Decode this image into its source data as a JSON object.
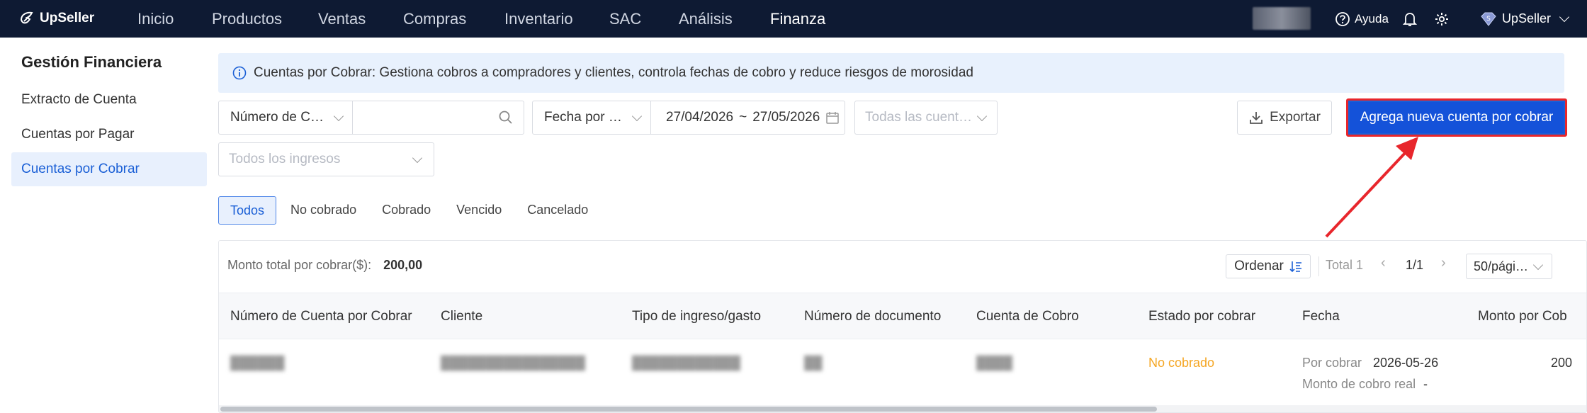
{
  "topnav": {
    "brand": "UpSeller",
    "items": [
      "Inicio",
      "Productos",
      "Ventas",
      "Compras",
      "Inventario",
      "SAC",
      "Análisis",
      "Finanza"
    ],
    "help": "Ayuda",
    "account": "UpSeller"
  },
  "sidebar": {
    "title": "Gestión Financiera",
    "items": [
      "Extracto de Cuenta",
      "Cuentas por Pagar",
      "Cuentas por Cobrar"
    ]
  },
  "info": {
    "text": "Cuentas por Cobrar: Gestiona cobros a compradores y clientes, controla fechas de cobro y reduce riesgos de morosidad"
  },
  "filters": {
    "search_field": "Número de C…",
    "search_value": "",
    "date_type": "Fecha por …",
    "date_from": "27/04/2026",
    "date_sep": "~",
    "date_to": "27/05/2026",
    "accounts_placeholder": "Todas las cuent…",
    "income_placeholder": "Todos los ingresos"
  },
  "actions": {
    "export": "Exportar",
    "add": "Agrega nueva cuenta por cobrar"
  },
  "tabs": [
    "Todos",
    "No cobrado",
    "Cobrado",
    "Vencido",
    "Cancelado"
  ],
  "summary": {
    "label": "Monto total por cobrar($):",
    "value": "200,00"
  },
  "toolbar": {
    "sort": "Ordenar",
    "total": "Total 1",
    "page": "1/1",
    "page_size": "50/pági…"
  },
  "table": {
    "columns": [
      "Número de Cuenta por Cobrar",
      "Cliente",
      "Tipo de ingreso/gasto",
      "Número de documento",
      "Cuenta de Cobro",
      "Estado por cobrar",
      "Fecha",
      "Monto por Cob"
    ],
    "rows": [
      {
        "number": "██████",
        "client": "████████████████",
        "type": "████████████",
        "document": "██",
        "account": "████",
        "status": "No cobrado",
        "date_label": "Por cobrar",
        "date_value": "2026-05-26",
        "real_label": "Monto de cobro real",
        "real_value": "-",
        "amount": "200"
      }
    ]
  },
  "colors": {
    "nav_bg": "#0e1a33",
    "primary": "#1452d9",
    "status_pending": "#f5a623",
    "highlight": "#e8262c"
  }
}
